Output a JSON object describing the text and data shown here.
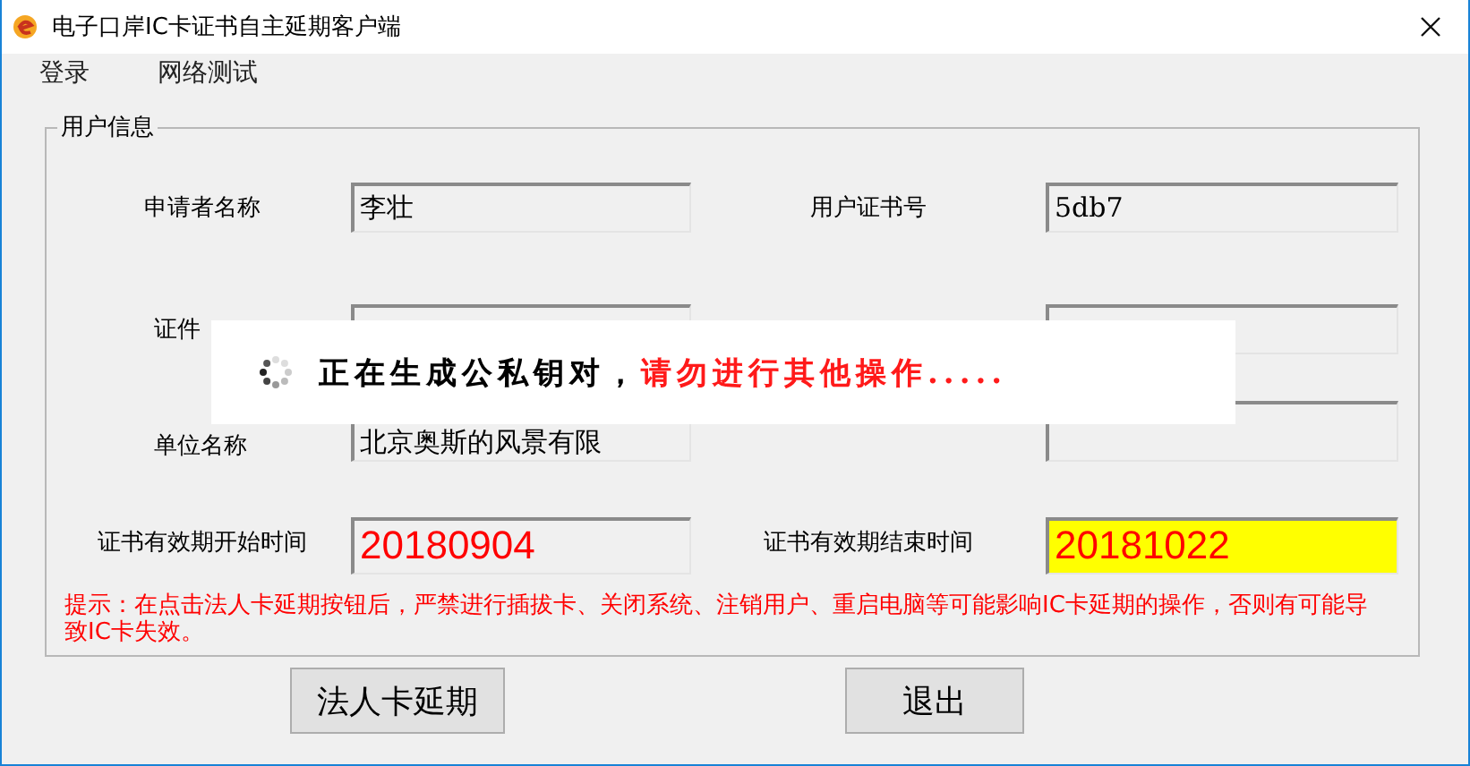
{
  "window": {
    "title": "电子口岸IC卡证书自主延期客户端"
  },
  "menu": [
    {
      "label": "登录"
    },
    {
      "label": "网络测试"
    }
  ],
  "group": {
    "title": "用户信息",
    "fields": [
      {
        "label": "申请者名称",
        "value": "李壮",
        "kind": "text"
      },
      {
        "label": "用户证书号",
        "value": "5db7",
        "kind": "text"
      },
      {
        "label": "证件",
        "kind": "text"
      },
      {
        "kind": "text"
      },
      {
        "label": "单位名称",
        "value": "北京奥斯的风景有限",
        "kind": "text"
      },
      {
        "kind": "text"
      },
      {
        "label": "证书有效期开始时间",
        "value": "20180904",
        "kind": "date",
        "highlighted": false
      },
      {
        "label": "证书有效期结束时间",
        "value": "20181022",
        "kind": "date",
        "highlighted": true
      }
    ],
    "tip": "提示：在点击法人卡延期按钮后，严禁进行插拔卡、关闭系统、注销用户、重启电脑等可能影响IC卡延期的操作，否则有可能导致IC卡失效。"
  },
  "buttons": [
    {
      "label": "法人卡延期"
    },
    {
      "label": "退出"
    }
  ],
  "loading": {
    "message": "正在生成公私钥对，",
    "warning": "请勿进行其他操作....."
  }
}
